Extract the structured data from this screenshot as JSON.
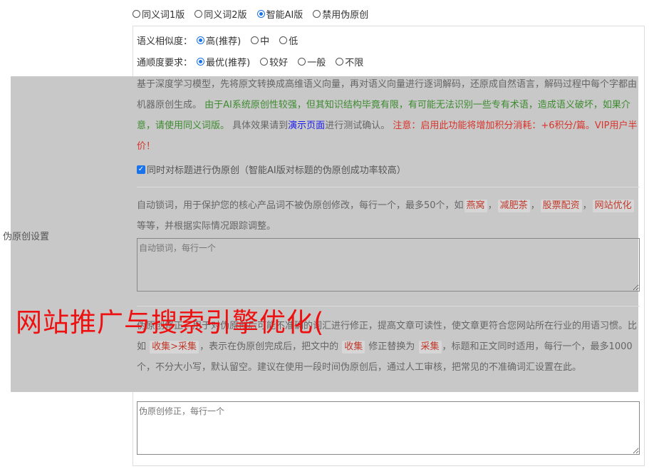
{
  "mode_options": [
    {
      "label": "同义词1版",
      "checked": false
    },
    {
      "label": "同义词2版",
      "checked": false
    },
    {
      "label": "智能AI版",
      "checked": true
    },
    {
      "label": "禁用伪原创",
      "checked": false
    }
  ],
  "similarity": {
    "label": "语义相似度：",
    "options": [
      {
        "label": "高(推荐)",
        "checked": true
      },
      {
        "label": "中",
        "checked": false
      },
      {
        "label": "低",
        "checked": false
      }
    ]
  },
  "fluency": {
    "label": "通顺度要求：",
    "options": [
      {
        "label": "最优(推荐)",
        "checked": true
      },
      {
        "label": "较好",
        "checked": false
      },
      {
        "label": "一般",
        "checked": false
      },
      {
        "label": "不限",
        "checked": false
      }
    ]
  },
  "settings_label": "伪原创设置",
  "ai_description": {
    "intro": "基于深度学习模型，先将原文转换成高维语义向量，再对语义向量进行逐词解码，还原成自然语言，解码过程中每个字都由机器原创生成。",
    "warning_green": "由于AI系统原创性较强，但其知识结构毕竟有限，有可能无法识别一些专有术语，造成语义破坏，如果介意，请使用同义词版。",
    "effect_prefix": "具体效果请到",
    "demo_link": "演示页面",
    "effect_suffix": "进行测试确认。",
    "notice_red": "注意：启用此功能将增加积分消耗：+6积分/篇。VIP用户半价！"
  },
  "title_rewrite": {
    "label": "同时对标题进行伪原创（智能AI版对标题的伪原创成功率较高）",
    "checked": true
  },
  "lock_words": {
    "desc_prefix": "自动锁词，用于保护您的核心产品词不被伪原创修改，每行一个，最多50个，如",
    "examples": [
      "燕窝",
      "减肥茶",
      "股票配资",
      "网站优化"
    ],
    "sep": "，",
    "desc_suffix": "等等，并根据实际情况跟踪调整。",
    "placeholder": "自动锁词，每行一个"
  },
  "correction": {
    "desc_part1": "伪原创修正，用于对伪原创后可能不准确的词汇进行修正，提高文章可读性，使文章更符合您网站所在行业的用语习惯。比如",
    "example_rule": "收集>采集",
    "desc_part2": "，表示在伪原创完成后，把文中的",
    "from_word": "收集",
    "desc_part3": "修正替换为",
    "to_word": "采集",
    "desc_part4": "，标题和正文同时适用，每行一个，最多1000个，不分大小写，默认留空。建议在使用一段时间伪原创后，通过人工审核，把常见的不准确词汇设置在此。",
    "placeholder": "伪原创修正，每行一个"
  },
  "watermark": "网站推广与搜索引擎优化(",
  "colors": {
    "accent": "#1a73e8",
    "overlay": "#c8c8c8",
    "warning_green": "#3d8b2f",
    "notice_red": "#d9342b",
    "watermark_red": "#ee1111"
  }
}
